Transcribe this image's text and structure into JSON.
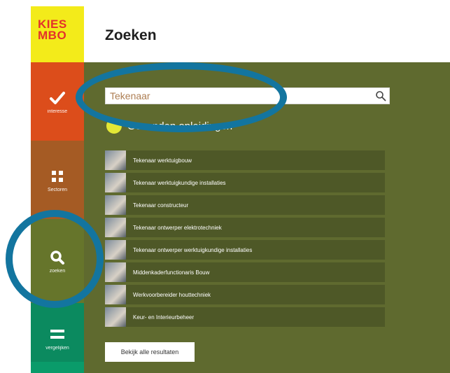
{
  "logo": {
    "line1": "KIES",
    "line2": "MBO"
  },
  "sidebar": {
    "items": [
      {
        "label": "interesse",
        "icon": "check-icon"
      },
      {
        "label": "Sectoren",
        "icon": "grid-icon"
      },
      {
        "label": "zoeken",
        "icon": "search-icon"
      },
      {
        "label": "vergelijken",
        "icon": "equals-icon"
      }
    ]
  },
  "header": {
    "title": "Zoeken"
  },
  "search": {
    "value": "Tekenaar",
    "icon": "search-icon"
  },
  "results": {
    "heading": "Gevonden opleidingen",
    "items": [
      "Tekenaar werktuigbouw",
      "Tekenaar werktuigkundige installaties",
      "Tekenaar constructeur",
      "Tekenaar ontwerper elektrotechniek",
      "Tekenaar ontwerper werktuigkundige installaties",
      "Middenkaderfunctionaris Bouw",
      "Werkvoorbereider houttechniek",
      "Keur- en Interieurbeheer"
    ],
    "all_button": "Bekijk alle resultaten"
  },
  "colors": {
    "content_bg": "#5f6a2f",
    "interesse": "#dc4d1b",
    "sectoren": "#a55b24",
    "zoeken": "#66752b",
    "vergelijken": "#0b8a5f",
    "highlight_ring": "#13759f"
  }
}
